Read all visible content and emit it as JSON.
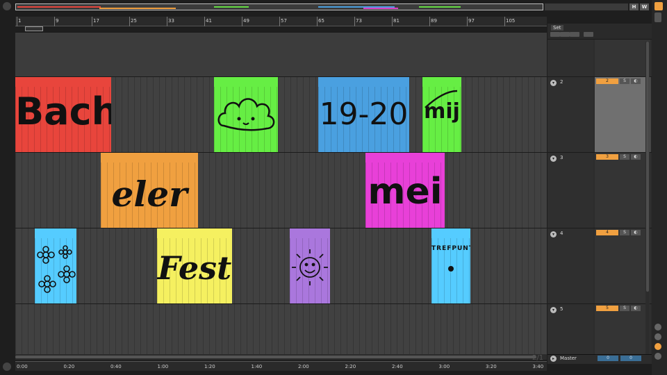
{
  "overview": {
    "segments": [
      {
        "color": "#e8453c"
      },
      {
        "color": "#f0a040"
      },
      {
        "color": "#66dd44"
      },
      {
        "color": "#dd44cc"
      },
      {
        "color": "#4aa0e0"
      },
      {
        "color": "#66dd44"
      }
    ],
    "buttons": [
      "H",
      "W"
    ]
  },
  "ruler": {
    "bars": [
      "1",
      "9",
      "17",
      "25",
      "33",
      "41",
      "49",
      "57",
      "65",
      "73",
      "81",
      "89",
      "97",
      "105"
    ]
  },
  "time_ruler": {
    "labels": [
      "0:00",
      "0:20",
      "0:40",
      "1:00",
      "1:20",
      "1:40",
      "2:00",
      "2:20",
      "2:40",
      "3:00",
      "3:20",
      "3:40"
    ]
  },
  "set_panel": {
    "label": "Set"
  },
  "tracks": [
    {
      "name": "2",
      "arm": "2",
      "solo": "S",
      "monitor": "◐"
    },
    {
      "name": "3",
      "arm": "3",
      "solo": "S",
      "monitor": "◐"
    },
    {
      "name": "4",
      "arm": "4",
      "solo": "S",
      "monitor": "◐"
    },
    {
      "name": "5",
      "arm": "5",
      "solo": "S",
      "monitor": "◐"
    }
  ],
  "master": {
    "name": "Master",
    "vol_left": "0",
    "vol_right": "0"
  },
  "page_indicator": "2/1",
  "clips": {
    "bach": {
      "text": "Bach",
      "color": "#e8453c"
    },
    "cloud": {
      "icon": "cloud-icon",
      "color": "#66ee44"
    },
    "date": {
      "text": "19-20",
      "color": "#4aa0e0"
    },
    "mij": {
      "text": "mij",
      "color": "#66ee44"
    },
    "eler": {
      "text": "eler",
      "color": "#f0a040"
    },
    "mei": {
      "text": "mei",
      "color": "#e840d8"
    },
    "flowers": {
      "icon": "flowers-icon",
      "color": "#55ccff"
    },
    "fest": {
      "text": "Fest",
      "color": "#f5f060"
    },
    "sun": {
      "icon": "sun-icon",
      "color": "#aa77dd"
    },
    "trefpunt": {
      "text": "TREFPUNT",
      "color": "#55ccff"
    }
  }
}
